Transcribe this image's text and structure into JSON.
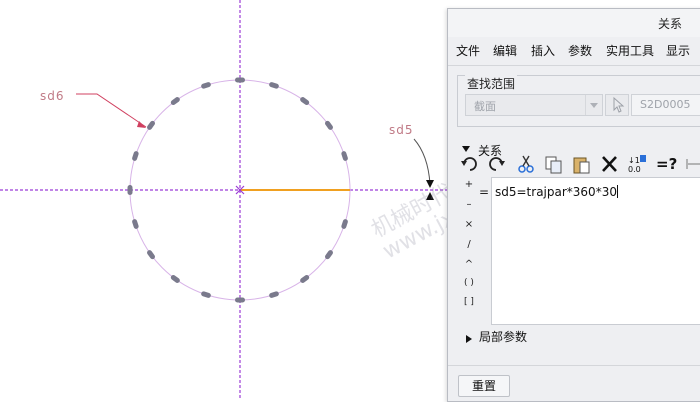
{
  "sketch": {
    "labels": {
      "sd6": "sd6",
      "sd5": "sd5"
    },
    "colors": {
      "axis": "#9b3bd6",
      "circle": "#d8b4e8",
      "dash": "#6e6e80",
      "dim_line": "#f0a020",
      "leader": "#d04060"
    }
  },
  "watermark": {
    "line1": "机械时代网",
    "line2": "www.jxage.com"
  },
  "dialog": {
    "title": "关系",
    "menu": [
      "文件",
      "编辑",
      "插入",
      "参数",
      "实用工具",
      "显示"
    ],
    "find_scope": {
      "label": "查找范围",
      "dropdown_value": "截面",
      "selection_value": "S2D0005"
    },
    "relations_section": "关系",
    "toolbar_icons": [
      "undo-icon",
      "redo-icon",
      "cut-icon",
      "copy-icon",
      "paste-icon",
      "delete-icon",
      "sort-icon",
      "evaluate-icon",
      "dimension-icon"
    ],
    "operators": [
      "+",
      "–",
      "×",
      "/",
      "^",
      "( )",
      "[ ]"
    ],
    "equals_label": "=",
    "relation_text": "sd5=trajpar*360*30",
    "local_params_section": "局部参数",
    "reset_button": "重置"
  }
}
